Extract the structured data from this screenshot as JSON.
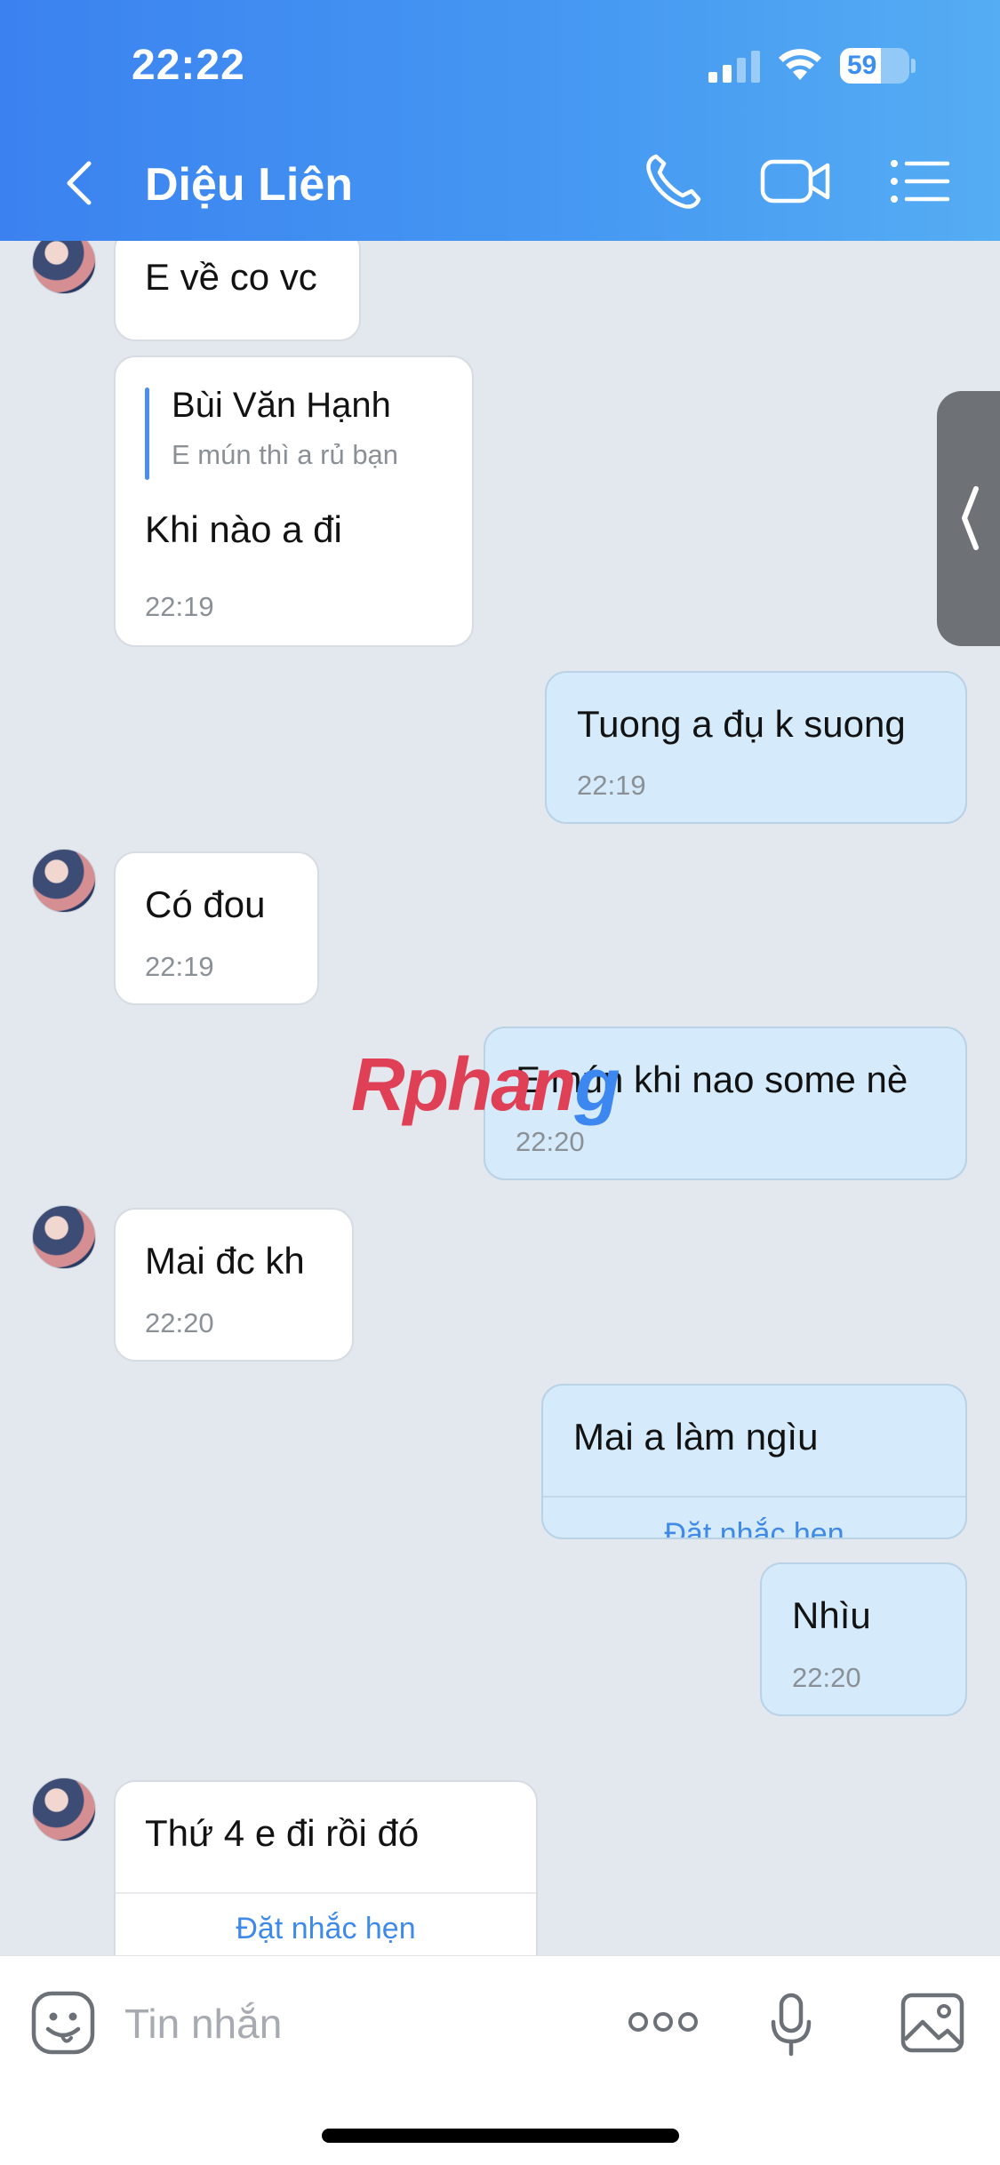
{
  "status_bar": {
    "time": "22:22",
    "battery": "59"
  },
  "header": {
    "title": "Diệu Liên"
  },
  "messages": [
    {
      "text": "E về co vc"
    },
    {
      "quote_name": "Bùi Văn Hạnh",
      "quote_text": "E mún thì a rủ bạn",
      "text": "Khi nào a đi",
      "time": "22:19"
    },
    {
      "text": "Tuong a đụ k suong",
      "time": "22:19"
    },
    {
      "text": "Có đou",
      "time": "22:19"
    },
    {
      "text": "E mún khi nao some nè",
      "time": "22:20"
    },
    {
      "text": "Mai đc kh",
      "time": "22:20"
    },
    {
      "text": "Mai a làm ngìu",
      "action": "Đặt nhắc hẹn"
    },
    {
      "text": "Nhìu",
      "time": "22:20"
    },
    {
      "text": "Thứ 4 e đi rồi đó",
      "action": "Đặt nhắc hẹn"
    }
  ],
  "watermark": {
    "part1": "Rphan",
    "part2": "g"
  },
  "input": {
    "placeholder": "Tin nhắn"
  },
  "icons": {
    "back": "chevron-left-icon",
    "call": "phone-icon",
    "video": "video-camera-icon",
    "menu": "list-icon",
    "sticker": "sticker-icon",
    "more": "more-icon",
    "mic": "microphone-icon",
    "image": "image-icon",
    "side_handle": "chevron-left-icon"
  },
  "colors": {
    "header_start": "#3b82f0",
    "header_end": "#55adf3",
    "outgoing_bubble": "#d5ebfb",
    "incoming_bubble": "#ffffff",
    "chat_bg": "#e3e7ee",
    "link": "#3f8ae8"
  }
}
